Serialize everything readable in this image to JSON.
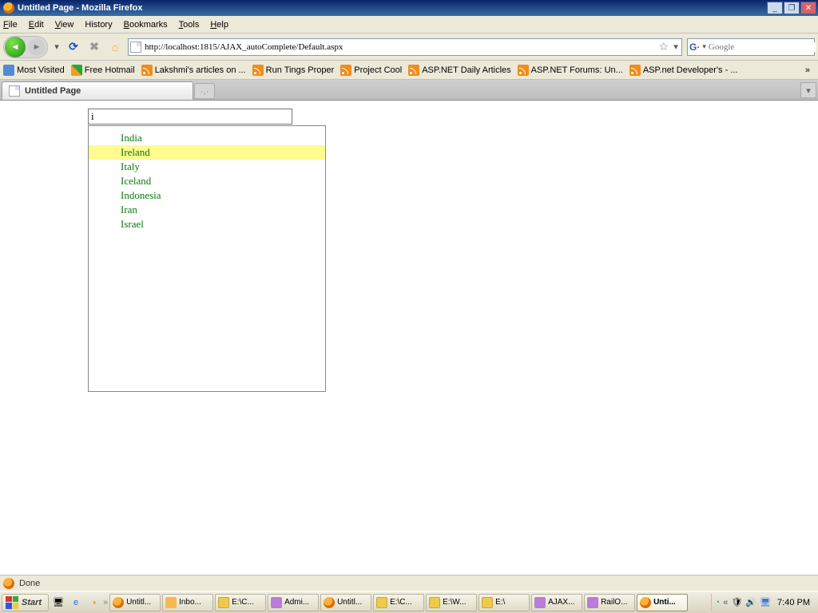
{
  "window": {
    "title": "Untitled Page - Mozilla Firefox"
  },
  "menu": {
    "file": "File",
    "edit": "Edit",
    "view": "View",
    "history": "History",
    "bookmarks": "Bookmarks",
    "tools": "Tools",
    "help": "Help"
  },
  "nav": {
    "url": "http://localhost:1815/AJAX_autoComplete/Default.aspx",
    "search_placeholder": "Google"
  },
  "bookmarks": [
    {
      "icon": "mv",
      "label": "Most Visited"
    },
    {
      "icon": "hm",
      "label": "Free Hotmail"
    },
    {
      "icon": "rss",
      "label": "Lakshmi's articles on ..."
    },
    {
      "icon": "rss",
      "label": "Run Tings Proper"
    },
    {
      "icon": "rss",
      "label": "Project Cool"
    },
    {
      "icon": "rss",
      "label": "ASP.NET Daily Articles"
    },
    {
      "icon": "rss",
      "label": "ASP.NET Forums: Un..."
    },
    {
      "icon": "rss",
      "label": "ASP.net Developer's - ..."
    }
  ],
  "tab": {
    "title": "Untitled Page"
  },
  "autocomplete": {
    "input_value": "i",
    "items": [
      "India",
      "Ireland",
      "Italy",
      "Iceland",
      "Indonesia",
      "Iran",
      "Israel"
    ],
    "highlighted_index": 1
  },
  "status": {
    "text": "Done"
  },
  "taskbar": {
    "start": "Start",
    "buttons": [
      {
        "icon": "ff",
        "label": "Untitl..."
      },
      {
        "icon": "ol",
        "label": "Inbo..."
      },
      {
        "icon": "fl",
        "label": "E:\\C..."
      },
      {
        "icon": "vs",
        "label": "Admi..."
      },
      {
        "icon": "ff",
        "label": "Untitl..."
      },
      {
        "icon": "fl",
        "label": "E:\\C..."
      },
      {
        "icon": "fl",
        "label": "E:\\W..."
      },
      {
        "icon": "fl",
        "label": "E:\\"
      },
      {
        "icon": "vs",
        "label": "AJAX..."
      },
      {
        "icon": "vs",
        "label": "RailO..."
      },
      {
        "icon": "ff",
        "label": "Unti...",
        "active": true
      }
    ],
    "clock": "7:40 PM"
  }
}
